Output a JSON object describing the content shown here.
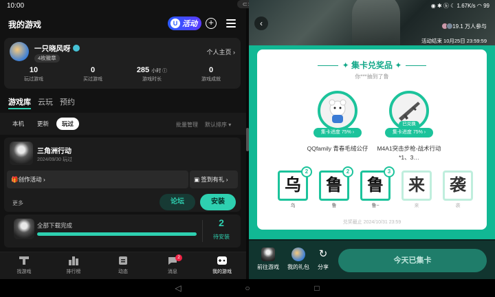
{
  "left": {
    "status_time": "10:00",
    "header_title": "我的游戏",
    "activity_badge": "活动",
    "profile": {
      "name": "一只晓风呀",
      "medal": "4枚徽章",
      "home_link": "个人主页 ›",
      "stats": [
        {
          "value": "10",
          "unit": "",
          "label": "玩过游戏"
        },
        {
          "value": "0",
          "unit": "",
          "label": "买过游戏"
        },
        {
          "value": "285",
          "unit": "小时 ⓘ",
          "label": "游戏时长"
        },
        {
          "value": "0",
          "unit": "",
          "label": "游戏成就"
        }
      ]
    },
    "tabs": [
      "游戏库",
      "云玩",
      "预约"
    ],
    "filters": [
      "本机",
      "更新",
      "玩过"
    ],
    "batch_manage": "批量管理",
    "default_sort": "默认排序 ▾",
    "game": {
      "name": "三角洲行动",
      "date": "2024/09/30 玩过",
      "create_activity": "🎁创作活动 ›",
      "sign_gift": "签到有礼 ›",
      "more": "更多",
      "forum": "论坛",
      "install": "安装"
    },
    "download": {
      "text": "全部下载完成",
      "progress": 1.0,
      "count": "2",
      "label": "待安装"
    },
    "bottom_nav": [
      {
        "label": "找游戏",
        "icon": "game-search-icon"
      },
      {
        "label": "排行榜",
        "icon": "ranking-icon"
      },
      {
        "label": "动态",
        "icon": "feed-icon"
      },
      {
        "label": "消息",
        "icon": "message-icon",
        "badge": "2"
      },
      {
        "label": "我的游戏",
        "icon": "my-games-icon"
      }
    ]
  },
  "right": {
    "status_text": "◉ ✱ ⓑ ☾ 1.67K/s ◠ 99",
    "players": "19.1 万人参与",
    "end_time": "活动结束 10月25日 23:59:59",
    "card_title": "集卡兑奖品",
    "card_sub": "你***抽到了鲁",
    "prizes": [
      {
        "badge": "集卡进度 75% ›",
        "name": "QQfamily 青春毛绒公仔",
        "owned": ""
      },
      {
        "badge": "集卡进度 75% ›",
        "name": "M4A1突击步枪-战术行动*1、3…",
        "owned": "已兑换"
      }
    ],
    "cards": [
      {
        "char": "乌",
        "count": "2",
        "label": "乌",
        "collected": true
      },
      {
        "char": "鲁",
        "count": "2",
        "label": "鲁",
        "collected": true
      },
      {
        "char": "鲁",
        "count": "3",
        "label": "鲁~",
        "collected": true
      },
      {
        "char": "来",
        "count": "",
        "label": "来",
        "collected": false
      },
      {
        "char": "袭",
        "count": "",
        "label": "袭",
        "collected": false
      }
    ],
    "deadline": "兑奖截止 2024/10/31 23:59",
    "bottom": {
      "goto_game": "前往游戏",
      "my_gifts": "我的礼包",
      "share": "分享",
      "today_done": "今天已集卡"
    }
  },
  "colors": {
    "accent": "#2ed0b0",
    "panel": "#11b894",
    "card_border": "#1cc39b"
  }
}
